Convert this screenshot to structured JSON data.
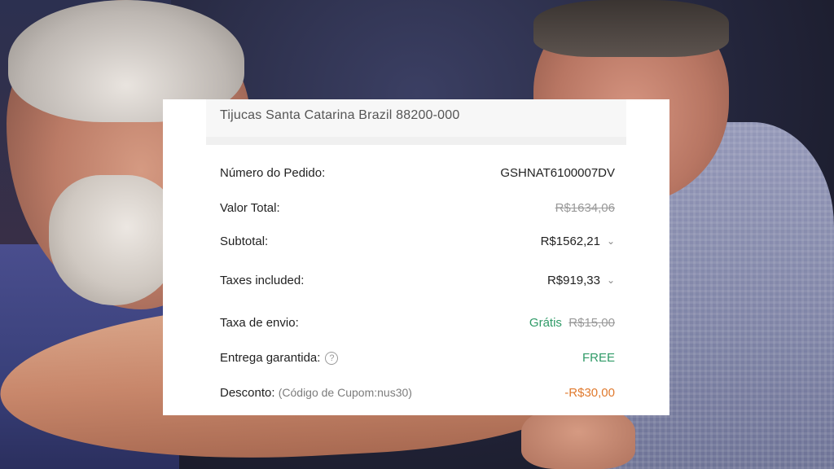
{
  "address": "Tijucas Santa Catarina Brazil 88200-000",
  "order": {
    "label": "Número do Pedido:",
    "value": "GSHNAT6100007DV"
  },
  "total": {
    "label": "Valor Total:",
    "value": "R$1634,06"
  },
  "subtotal": {
    "label": "Subtotal:",
    "value": "R$1562,21",
    "icon": "chevron-down-icon"
  },
  "taxes": {
    "label": "Taxes included:",
    "value": "R$919,33",
    "icon": "chevron-down-icon"
  },
  "shipping": {
    "label": "Taxa de envio:",
    "value": "Grátis",
    "old_value": "R$15,00"
  },
  "guarantee": {
    "label": "Entrega garantida:",
    "help": "?",
    "value": "FREE"
  },
  "discount": {
    "label": "Desconto:",
    "coupon": "(Código de Cupom:nus30)",
    "value": "-R$30,00"
  },
  "colors": {
    "green": "#2f9a67",
    "orange": "#e07a2e",
    "strike_gray": "#9a9a9a"
  }
}
